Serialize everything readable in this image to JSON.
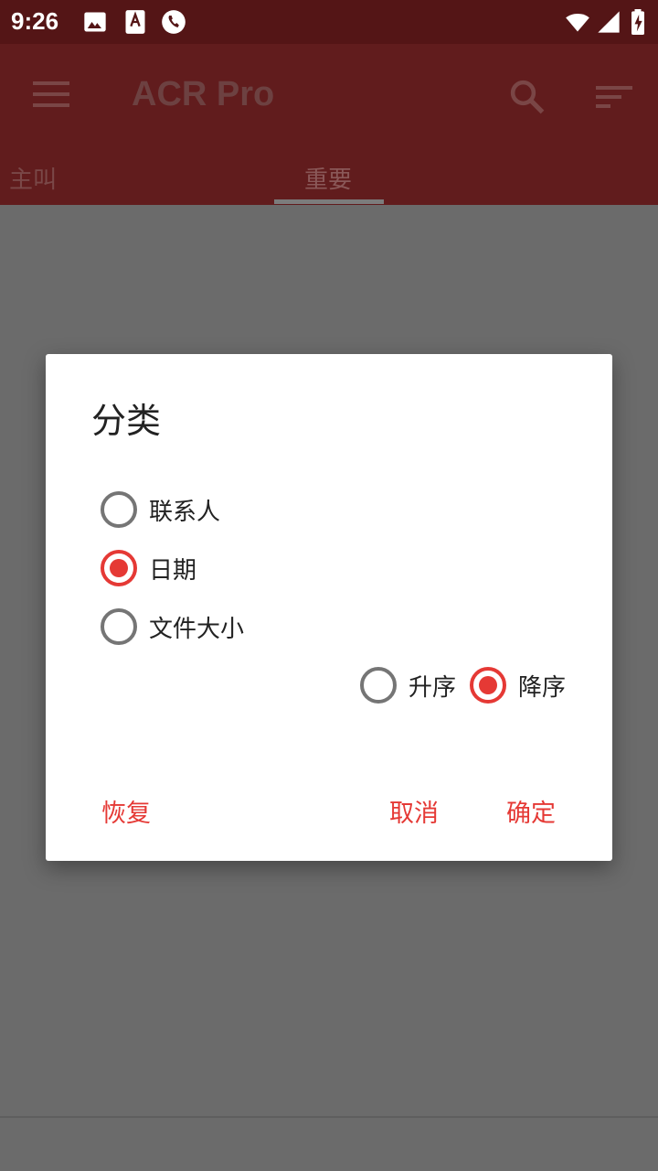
{
  "status_bar": {
    "time": "9:26"
  },
  "app_bar": {
    "title": "ACR Pro",
    "tabs": [
      {
        "label": "主叫"
      },
      {
        "label": "重要"
      }
    ]
  },
  "dialog": {
    "title": "分类",
    "sort_by_options": [
      {
        "label": "联系人",
        "checked": false
      },
      {
        "label": "日期",
        "checked": true
      },
      {
        "label": "文件大小",
        "checked": false
      }
    ],
    "order_options": [
      {
        "label": "升序",
        "checked": false
      },
      {
        "label": "降序",
        "checked": true
      }
    ],
    "buttons": {
      "reset": "恢复",
      "cancel": "取消",
      "ok": "确定"
    }
  },
  "colors": {
    "accent": "#e53935",
    "app_bar": "#611c1d",
    "status_bar": "#541516"
  }
}
